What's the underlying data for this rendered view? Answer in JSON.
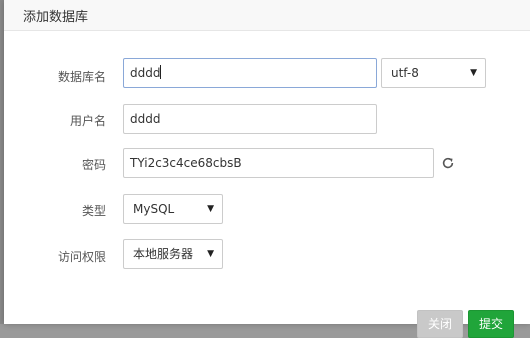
{
  "dialog": {
    "title": "添加数据库"
  },
  "form": {
    "db_name": {
      "label": "数据库名",
      "value": "dddd"
    },
    "charset": {
      "selected": "utf-8"
    },
    "username": {
      "label": "用户名",
      "value": "dddd"
    },
    "password": {
      "label": "密码",
      "value": "TYi2c3c4ce68cbsB"
    },
    "type": {
      "label": "类型",
      "selected": "MySQL"
    },
    "access": {
      "label": "访问权限",
      "selected": "本地服务器"
    }
  },
  "buttons": {
    "close_label": "关闭",
    "submit_label": "提交"
  },
  "colors": {
    "submit": "#20a53a",
    "close": "#c9c9c9"
  },
  "icons": {
    "refresh": "refresh-icon",
    "dropdown": "caret-down-icon"
  }
}
